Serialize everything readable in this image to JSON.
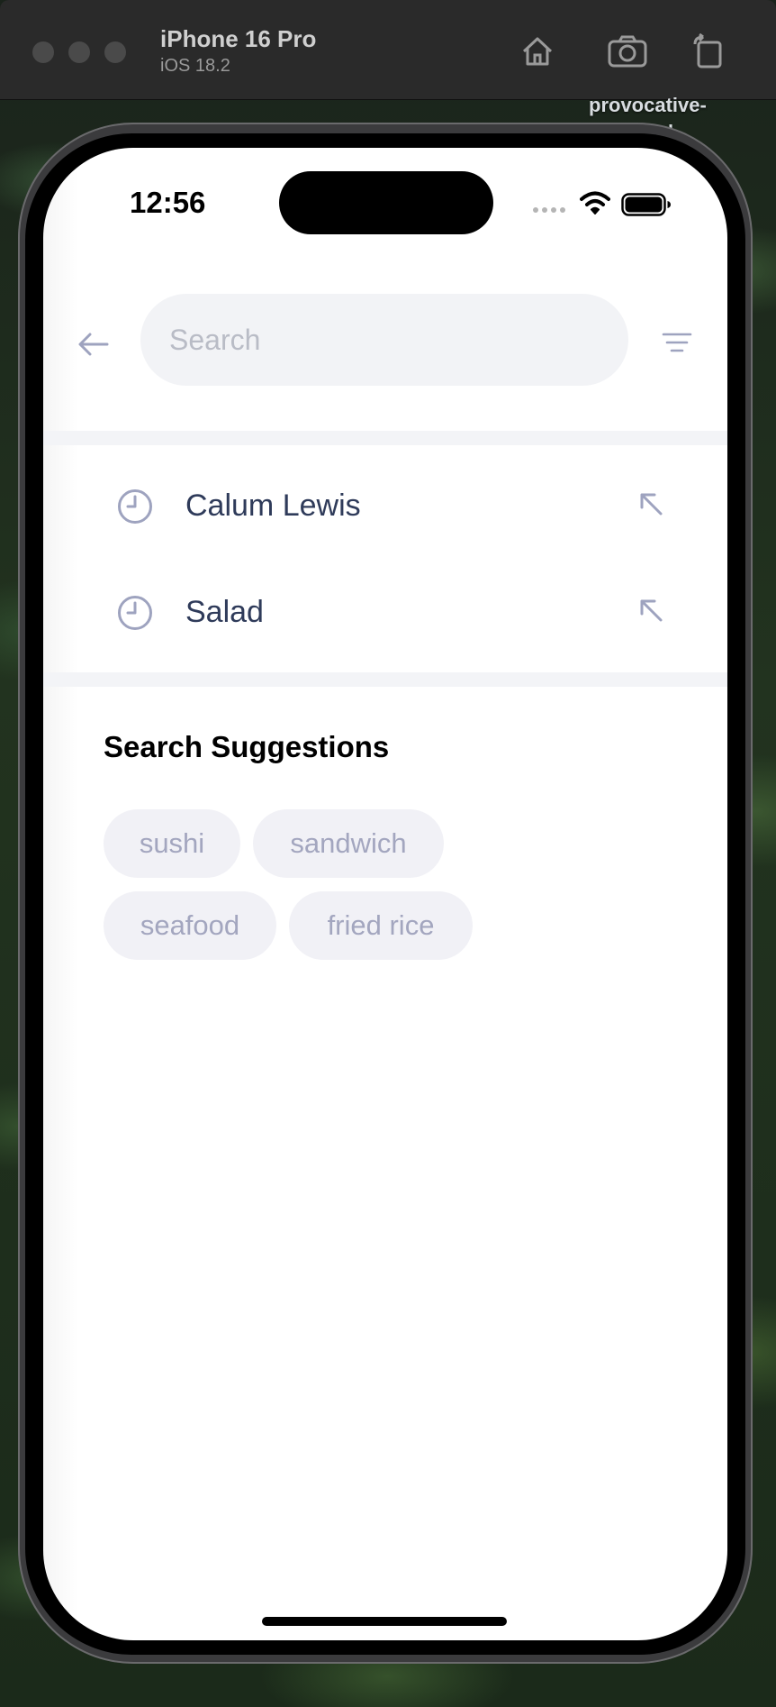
{
  "simulator": {
    "device_name": "iPhone 16 Pro",
    "os_version": "iOS 18.2",
    "desktop_label": "provocative-\n...end"
  },
  "status_bar": {
    "time": "12:56"
  },
  "search": {
    "placeholder": "Search",
    "value": ""
  },
  "recent_searches": [
    {
      "label": "Calum Lewis",
      "icon": "clock-icon",
      "action_icon": "arrow-up-left-icon"
    },
    {
      "label": "Salad",
      "icon": "clock-icon",
      "action_icon": "arrow-up-left-icon"
    }
  ],
  "suggestions": {
    "title": "Search Suggestions",
    "items": [
      "sushi",
      "sandwich",
      "seafood",
      "fried rice"
    ]
  },
  "colors": {
    "accent_text": "#2f3b5a",
    "icon": "#9ea3bf",
    "chip_bg": "#f1f1f6",
    "chip_text": "#a3a6bf",
    "search_bg": "#f2f3f6"
  }
}
